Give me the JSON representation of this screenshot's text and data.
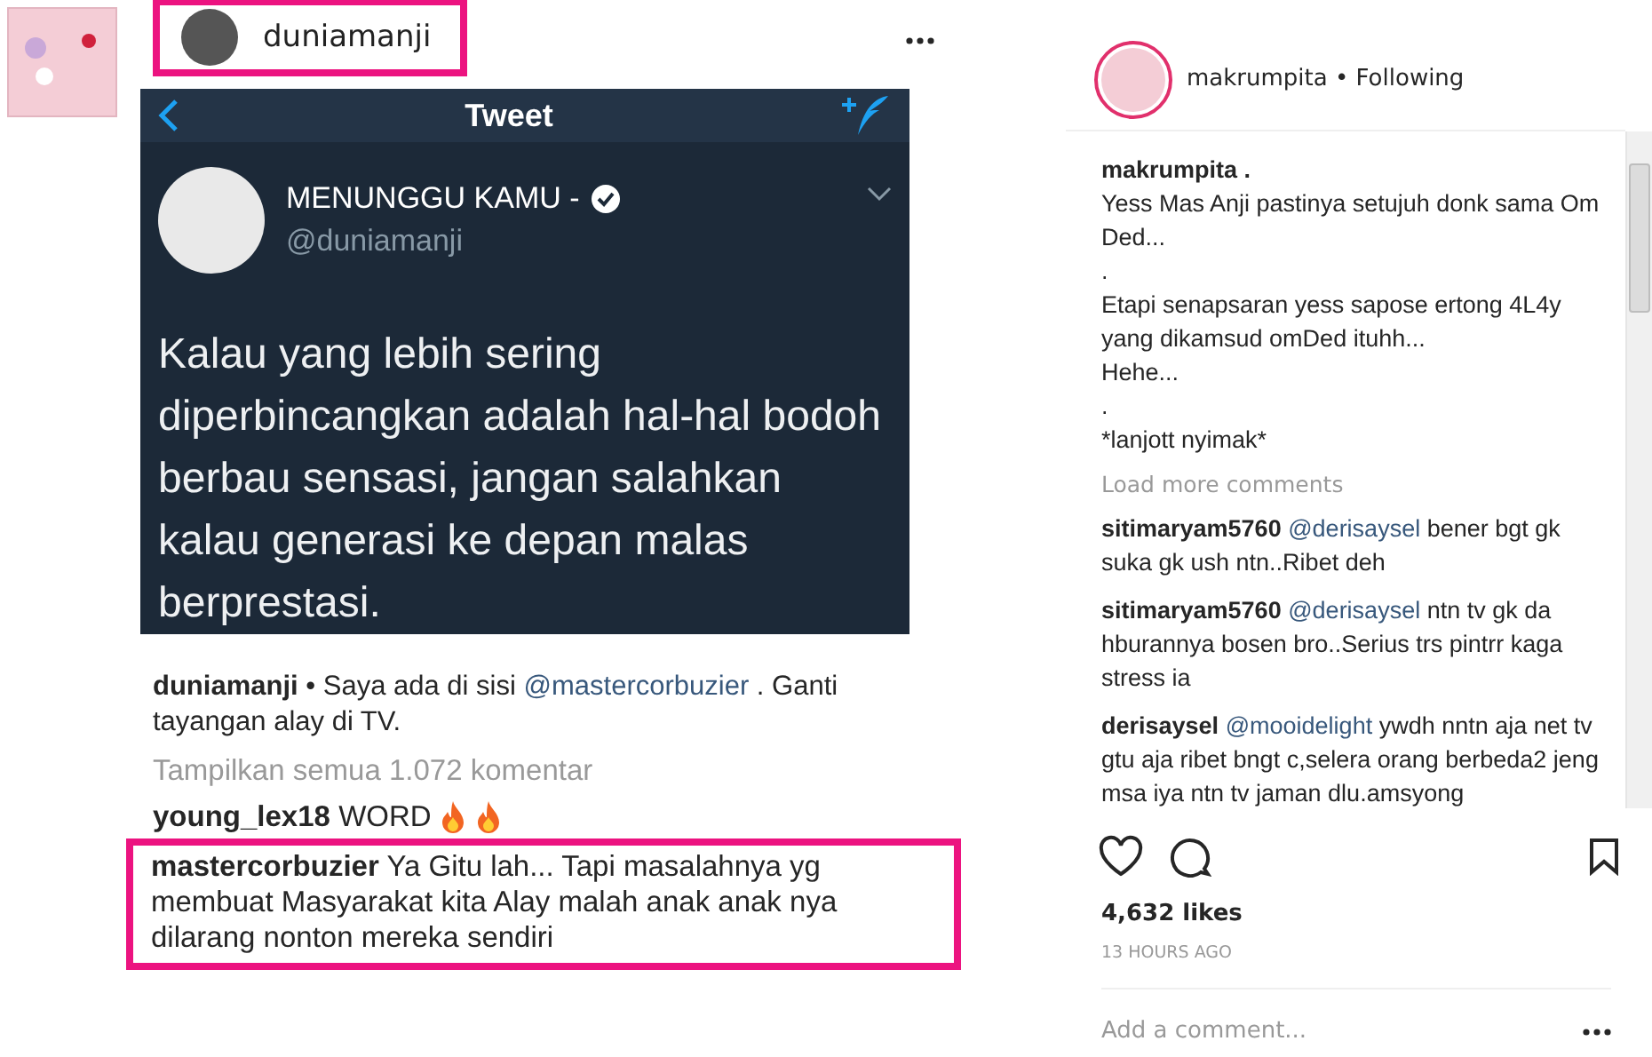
{
  "post_image": {
    "header": {
      "username": "duniamanji",
      "highlighted": true
    },
    "tweet": {
      "title": "Tweet",
      "name": "MENUNGGU KAMU -",
      "verified": true,
      "handle": "@duniamanji",
      "text": "Kalau yang lebih sering diperbincangkan adalah hal-hal bodoh berbau sensasi, jangan salahkan kalau generasi ke depan malas berprestasi."
    },
    "caption": {
      "username": "duniamanji",
      "before": "• Saya ada di sisi",
      "mention": "@mastercorbuzier",
      "after": ". Ganti tayangan alay di TV."
    },
    "view_all": "Tampilkan semua 1.072 komentar",
    "comments": [
      {
        "username": "young_lex18",
        "text": "WORD",
        "highlighted": false
      },
      {
        "username": "mastercorbuzier",
        "text": "Ya Gitu lah... Tapi masalahnya yg membuat Masyarakat kita Alay malah anak anak nya dilarang nonton mereka sendiri",
        "highlighted": true
      }
    ]
  },
  "panel": {
    "username": "makrumpita",
    "separator": "•",
    "follow_status": "Following",
    "caption": {
      "username": "makrumpita .",
      "lines": [
        "Yess Mas Anji pastinya setujuh donk sama Om Ded...",
        ".",
        "Etapi senapsaran yess sapose ertong 4L4y yang dikamsud omDed ituhh...",
        "Hehe...",
        ".",
        "*lanjott nyimak*"
      ]
    },
    "load_more": "Load more comments",
    "comments": [
      {
        "username": "sitimaryam5760",
        "mention": "@derisaysel",
        "text": "bener bgt gk suka gk ush ntn..Ribet deh"
      },
      {
        "username": "sitimaryam5760",
        "mention": "@derisaysel",
        "text": "ntn tv gk da hburannya bosen bro..Serius trs pintrr kaga stress ia"
      },
      {
        "username": "derisaysel",
        "mention": "@mooidelight",
        "text": "ywdh nntn aja net tv gtu aja ribet bngt c,selera orang berbeda2 jeng msa iya ntn tv jaman dlu.amsyong"
      }
    ],
    "likes": "4,632 likes",
    "time": "13 HOURS AGO",
    "comment_placeholder": "Add a comment..."
  }
}
